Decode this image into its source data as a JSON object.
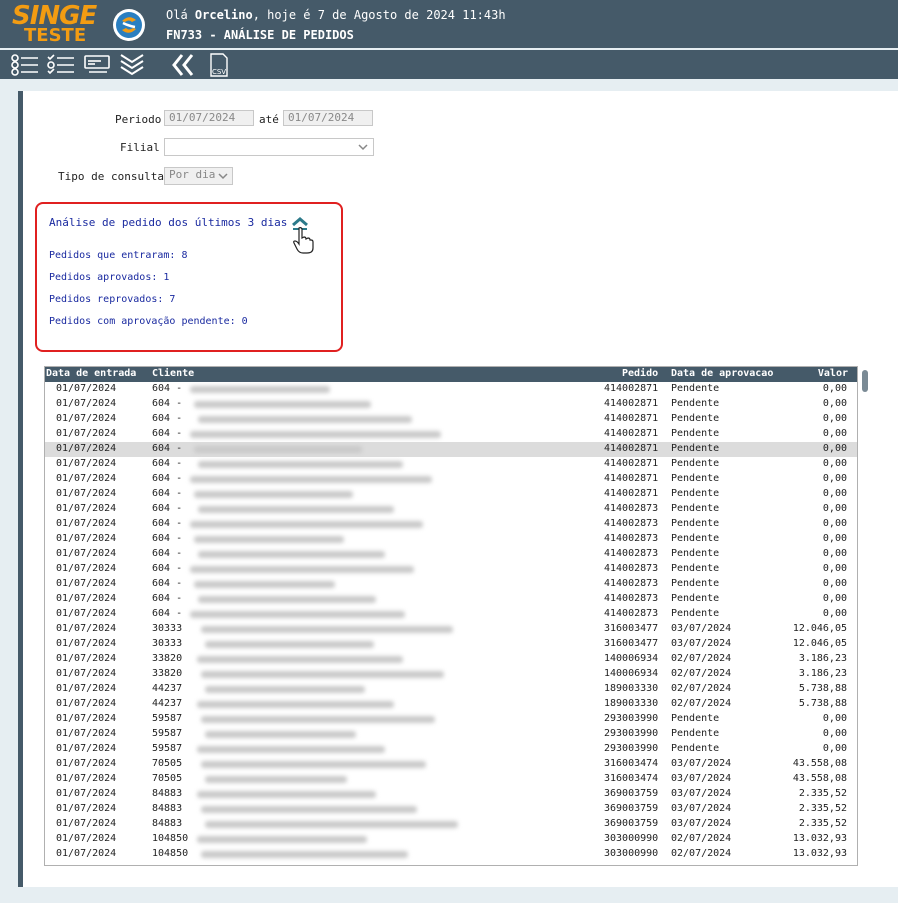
{
  "header": {
    "logo": "SINGE",
    "logo_sub": "TESTE",
    "greeting_prefix": "Olá ",
    "user": "Orcelino",
    "greeting_suffix": ", hoje é 7 de Agosto de 2024 11:43h",
    "screen_title": "FN733 - ANÁLISE DE PEDIDOS"
  },
  "toolbar": {
    "csv_label": "CSV"
  },
  "filters": {
    "periodo_label": "Periodo",
    "periodo_de": "01/07/2024",
    "ate_label": "até",
    "periodo_ate": "01/07/2024",
    "filial_label": "Filial",
    "tipo_label": "Tipo de consulta",
    "tipo_value": "Por dia"
  },
  "summary": {
    "title": "Análise de pedido dos últimos 3 dias",
    "line1": "Pedidos que entraram: 8",
    "line2": "Pedidos aprovados: 1",
    "line3": "Pedidos reprovados: 7",
    "line4": "Pedidos com aprovação pendente: 0"
  },
  "table": {
    "columns": [
      "Data de entrada",
      "Cliente",
      "Pedido",
      "Data de aprovacao",
      "Valor"
    ],
    "rows": [
      {
        "data": "01/07/2024",
        "cliente": "604 -",
        "pedido": "414002871",
        "aprov": "Pendente",
        "valor": "0,00"
      },
      {
        "data": "01/07/2024",
        "cliente": "604 -",
        "pedido": "414002871",
        "aprov": "Pendente",
        "valor": "0,00"
      },
      {
        "data": "01/07/2024",
        "cliente": "604 -",
        "pedido": "414002871",
        "aprov": "Pendente",
        "valor": "0,00"
      },
      {
        "data": "01/07/2024",
        "cliente": "604 -",
        "pedido": "414002871",
        "aprov": "Pendente",
        "valor": "0,00"
      },
      {
        "data": "01/07/2024",
        "cliente": "604 -",
        "pedido": "414002871",
        "aprov": "Pendente",
        "valor": "0,00"
      },
      {
        "data": "01/07/2024",
        "cliente": "604 -",
        "pedido": "414002871",
        "aprov": "Pendente",
        "valor": "0,00"
      },
      {
        "data": "01/07/2024",
        "cliente": "604 -",
        "pedido": "414002871",
        "aprov": "Pendente",
        "valor": "0,00"
      },
      {
        "data": "01/07/2024",
        "cliente": "604 -",
        "pedido": "414002871",
        "aprov": "Pendente",
        "valor": "0,00"
      },
      {
        "data": "01/07/2024",
        "cliente": "604 -",
        "pedido": "414002873",
        "aprov": "Pendente",
        "valor": "0,00"
      },
      {
        "data": "01/07/2024",
        "cliente": "604 -",
        "pedido": "414002873",
        "aprov": "Pendente",
        "valor": "0,00"
      },
      {
        "data": "01/07/2024",
        "cliente": "604 -",
        "pedido": "414002873",
        "aprov": "Pendente",
        "valor": "0,00"
      },
      {
        "data": "01/07/2024",
        "cliente": "604 -",
        "pedido": "414002873",
        "aprov": "Pendente",
        "valor": "0,00"
      },
      {
        "data": "01/07/2024",
        "cliente": "604 -",
        "pedido": "414002873",
        "aprov": "Pendente",
        "valor": "0,00"
      },
      {
        "data": "01/07/2024",
        "cliente": "604 -",
        "pedido": "414002873",
        "aprov": "Pendente",
        "valor": "0,00"
      },
      {
        "data": "01/07/2024",
        "cliente": "604 -",
        "pedido": "414002873",
        "aprov": "Pendente",
        "valor": "0,00"
      },
      {
        "data": "01/07/2024",
        "cliente": "604 -",
        "pedido": "414002873",
        "aprov": "Pendente",
        "valor": "0,00"
      },
      {
        "data": "01/07/2024",
        "cliente": "30333",
        "pedido": "316003477",
        "aprov": "03/07/2024",
        "valor": "12.046,05"
      },
      {
        "data": "01/07/2024",
        "cliente": "30333",
        "pedido": "316003477",
        "aprov": "03/07/2024",
        "valor": "12.046,05"
      },
      {
        "data": "01/07/2024",
        "cliente": "33820",
        "pedido": "140006934",
        "aprov": "02/07/2024",
        "valor": "3.186,23"
      },
      {
        "data": "01/07/2024",
        "cliente": "33820",
        "pedido": "140006934",
        "aprov": "02/07/2024",
        "valor": "3.186,23"
      },
      {
        "data": "01/07/2024",
        "cliente": "44237",
        "pedido": "189003330",
        "aprov": "02/07/2024",
        "valor": "5.738,88"
      },
      {
        "data": "01/07/2024",
        "cliente": "44237",
        "pedido": "189003330",
        "aprov": "02/07/2024",
        "valor": "5.738,88"
      },
      {
        "data": "01/07/2024",
        "cliente": "59587",
        "pedido": "293003990",
        "aprov": "Pendente",
        "valor": "0,00"
      },
      {
        "data": "01/07/2024",
        "cliente": "59587",
        "pedido": "293003990",
        "aprov": "Pendente",
        "valor": "0,00"
      },
      {
        "data": "01/07/2024",
        "cliente": "59587",
        "pedido": "293003990",
        "aprov": "Pendente",
        "valor": "0,00"
      },
      {
        "data": "01/07/2024",
        "cliente": "70505",
        "pedido": "316003474",
        "aprov": "03/07/2024",
        "valor": "43.558,08"
      },
      {
        "data": "01/07/2024",
        "cliente": "70505",
        "pedido": "316003474",
        "aprov": "03/07/2024",
        "valor": "43.558,08"
      },
      {
        "data": "01/07/2024",
        "cliente": "84883",
        "pedido": "369003759",
        "aprov": "03/07/2024",
        "valor": "2.335,52"
      },
      {
        "data": "01/07/2024",
        "cliente": "84883",
        "pedido": "369003759",
        "aprov": "03/07/2024",
        "valor": "2.335,52"
      },
      {
        "data": "01/07/2024",
        "cliente": "84883",
        "pedido": "369003759",
        "aprov": "03/07/2024",
        "valor": "2.335,52"
      },
      {
        "data": "01/07/2024",
        "cliente": "104850",
        "pedido": "303000990",
        "aprov": "02/07/2024",
        "valor": "13.032,93"
      },
      {
        "data": "01/07/2024",
        "cliente": "104850",
        "pedido": "303000990",
        "aprov": "02/07/2024",
        "valor": "13.032,93"
      }
    ]
  },
  "colors": {
    "header_bg": "#455a69",
    "logo": "#f39c12",
    "summary_border": "#e02020",
    "summary_text": "#1a2aa0"
  }
}
